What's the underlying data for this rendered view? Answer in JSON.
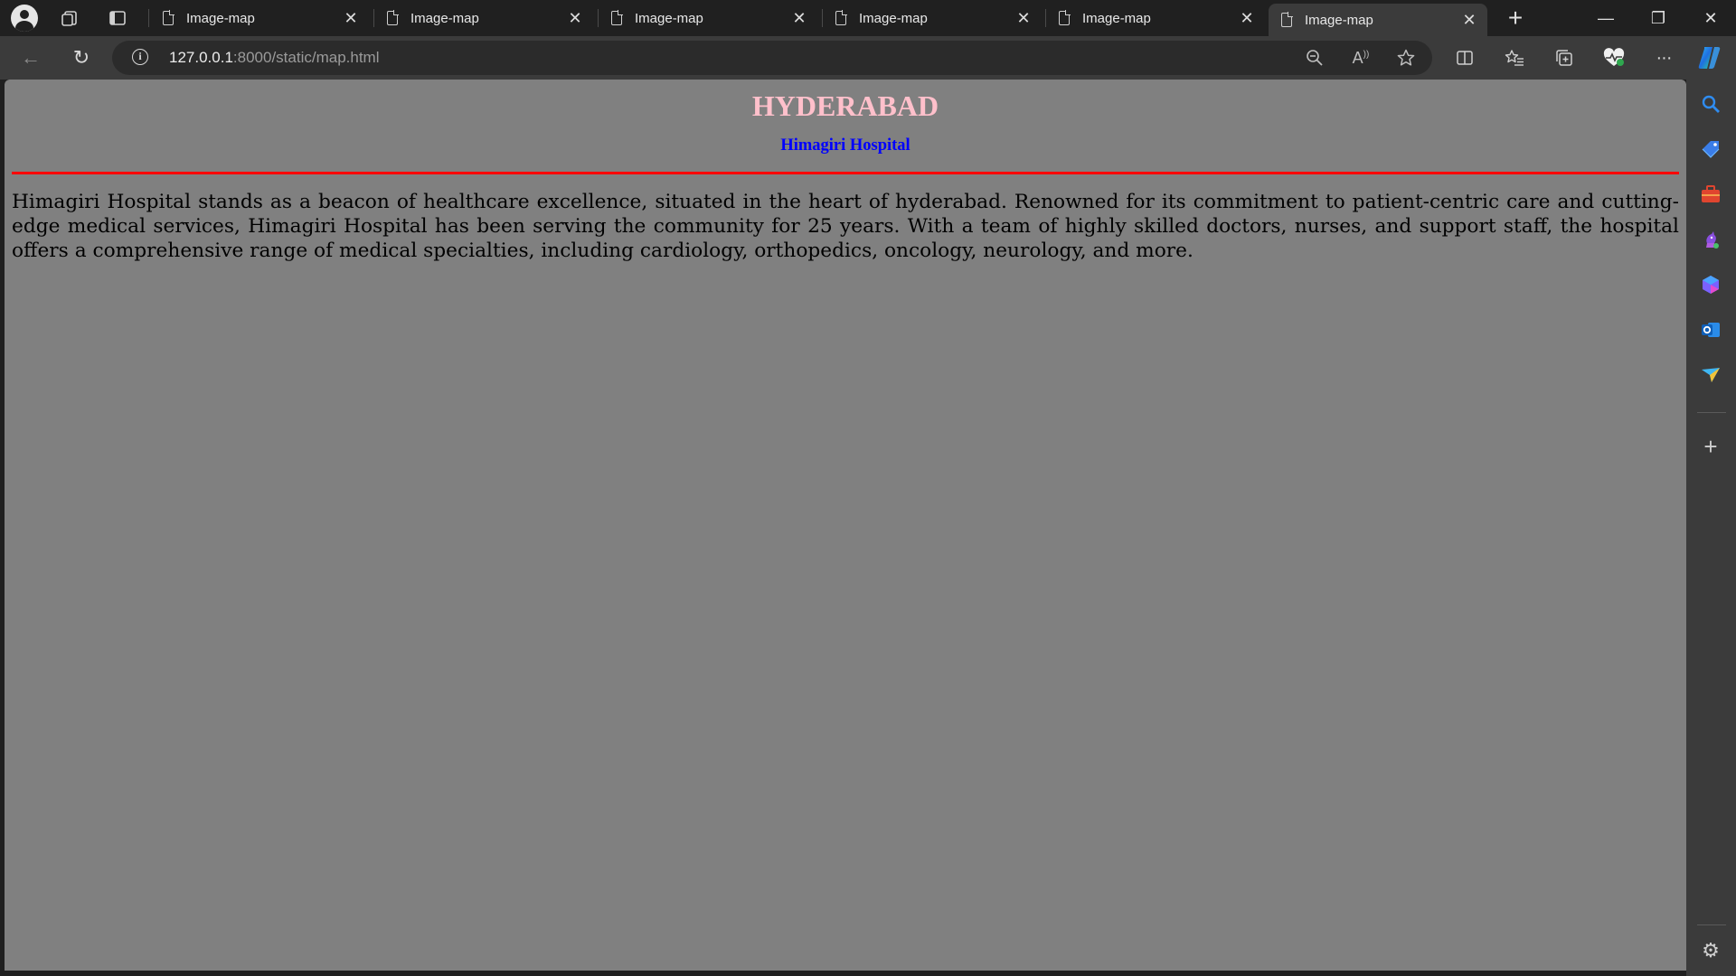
{
  "browser": {
    "tabs": [
      {
        "title": "Image-map",
        "active": false
      },
      {
        "title": "Image-map",
        "active": false
      },
      {
        "title": "Image-map",
        "active": false
      },
      {
        "title": "Image-map",
        "active": false
      },
      {
        "title": "Image-map",
        "active": false
      },
      {
        "title": "Image-map",
        "active": true
      }
    ],
    "tab_close_glyph": "✕",
    "new_tab_glyph": "+",
    "url_host": "127.0.0.1",
    "url_rest": ":8000/static/map.html",
    "window_controls": {
      "minimize": "—",
      "restore": "❐",
      "close": "✕"
    },
    "toolbar": {
      "back": "←",
      "reload": "↻",
      "more": "···"
    },
    "sidebar_icons": [
      "search-icon",
      "shopping-tag-icon",
      "tools-icon",
      "games-icon",
      "copilot-icon",
      "outlook-icon",
      "send-icon"
    ],
    "sidebar_add": "+",
    "sidebar_settings": "⚙"
  },
  "page": {
    "title": "HYDERABAD",
    "subtitle": "Himagiri Hospital",
    "paragraph": "Himagiri Hospital stands as a beacon of healthcare excellence, situated in the heart of hyderabad. Renowned for its commitment to patient-centric care and cutting-edge medical services, Himagiri Hospital has been serving the community for 25 years. With a team of highly skilled doctors, nurses, and support staff, the hospital offers a comprehensive range of medical specialties, including cardiology, orthopedics, oncology, neurology, and more."
  },
  "colors": {
    "page_background": "#808080",
    "title": "#ffc0cb",
    "subtitle": "#0000ff",
    "rule": "#ff0000"
  }
}
